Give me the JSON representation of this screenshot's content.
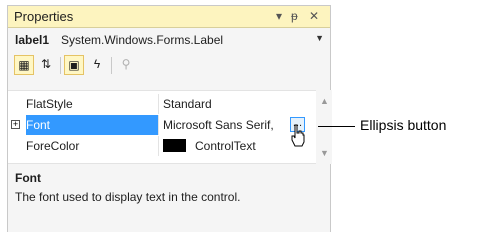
{
  "window": {
    "title": "Properties",
    "controls": {
      "dropdown": "▾",
      "pin": "ᵽ",
      "close": "✕"
    }
  },
  "object_selector": {
    "name": "label1",
    "type": "System.Windows.Forms.Label",
    "arrow": "▼"
  },
  "toolbar": {
    "buttons": [
      {
        "icon": "categorized-icon",
        "glyph": "▦",
        "checked": true
      },
      {
        "icon": "alphabetical-sort-icon",
        "glyph": "⇅",
        "checked": false
      },
      {
        "icon": "properties-icon",
        "glyph": "▣",
        "checked": true
      },
      {
        "icon": "events-icon",
        "glyph": "ϟ",
        "checked": false
      },
      {
        "icon": "property-pages-icon",
        "glyph": "⚲",
        "checked": false,
        "disabled": true
      }
    ]
  },
  "grid": {
    "rows": [
      {
        "name": "FlatStyle",
        "value": "Standard"
      },
      {
        "name": "Font",
        "value": "Microsoft Sans Serif,",
        "expander": "+",
        "selected": true
      },
      {
        "name": "ForeColor",
        "value": "ControlText",
        "swatch": "#000000"
      }
    ],
    "ellipsis_label": "..."
  },
  "description": {
    "title": "Font",
    "text": "The font used to display text in the control."
  },
  "callout": {
    "label": "Ellipsis button"
  },
  "colors": {
    "title_bar": "#fdf4bf",
    "selection": "#3399ff",
    "ellipsis_border": "#3399ff"
  }
}
